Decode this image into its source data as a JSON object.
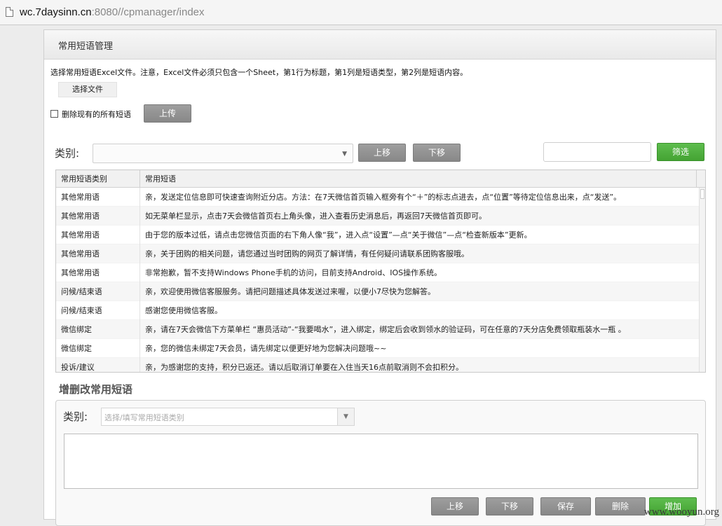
{
  "browser": {
    "url_host": "wc.7daysinn.cn",
    "url_rest": ":8080//cpmanager/index"
  },
  "panel": {
    "title": "常用短语管理",
    "instructions": "选择常用短语Excel文件。注意，Excel文件必须只包含一个Sheet，第1行为标题，第1列是短语类型，第2列是短语内容。",
    "choose_file_label": "选择文件",
    "delete_all_label": "删除现有的所有短语",
    "upload_label": "上传"
  },
  "filter": {
    "category_label": "类别:",
    "move_up_label": "上移",
    "move_down_label": "下移",
    "filter_label": "筛选"
  },
  "grid": {
    "columns": [
      "常用短语类别",
      "常用短语"
    ],
    "rows": [
      {
        "category": "其他常用语",
        "phrase": "亲，发送定位信息即可快速查询附近分店。方法：在7天微信首页输入框旁有个“＋”的标志点进去，点“位置”等待定位信息出来，点“发送”。"
      },
      {
        "category": "其他常用语",
        "phrase": "如无菜单栏显示，点击7天会微信首页右上角头像，进入查看历史消息后，再返回7天微信首页即可。"
      },
      {
        "category": "其他常用语",
        "phrase": "由于您的版本过低，请点击您微信页面的右下角人像“我”，进入点“设置”—点“关于微信”—点“检查新版本”更新。"
      },
      {
        "category": "其他常用语",
        "phrase": "亲，关于团购的相关问题，请您通过当时团购的网页了解详情，有任何疑问请联系团购客服哦。"
      },
      {
        "category": "其他常用语",
        "phrase": "非常抱歉，暂不支持Windows Phone手机的访问，目前支持Android、IOS操作系统。"
      },
      {
        "category": "问候/结束语",
        "phrase": "亲，欢迎使用微信客服服务。请把问题描述具体发送过来喔，以便小7尽快为您解答。"
      },
      {
        "category": "问候/结束语",
        "phrase": "感谢您使用微信客服。"
      },
      {
        "category": "微信绑定",
        "phrase": "亲，请在7天会微信下方菜单栏 “惠员活动”-“我要喝水”，进入绑定，绑定后会收到领水的验证码，可在任意的7天分店免费领取瓶装水一瓶 。"
      },
      {
        "category": "微信绑定",
        "phrase": "亲，您的微信未绑定7天会员，请先绑定以便更好地为您解决问题哦~~"
      },
      {
        "category": "投诉/建议",
        "phrase": "亲，为感谢您的支持，积分已返还。请以后取消订单要在入住当天16点前取消则不会扣积分。"
      }
    ]
  },
  "editor": {
    "title": "增删改常用短语",
    "category_label": "类别:",
    "category_placeholder": "选择/填写常用短语类别",
    "move_up_label": "上移",
    "move_down_label": "下移",
    "save_label": "保存",
    "delete_label": "删除",
    "add_label": "增加"
  },
  "watermark": "www.wooyun.org",
  "colors": {
    "primary_button": "#909090",
    "accent_button": "#4cae3c"
  }
}
